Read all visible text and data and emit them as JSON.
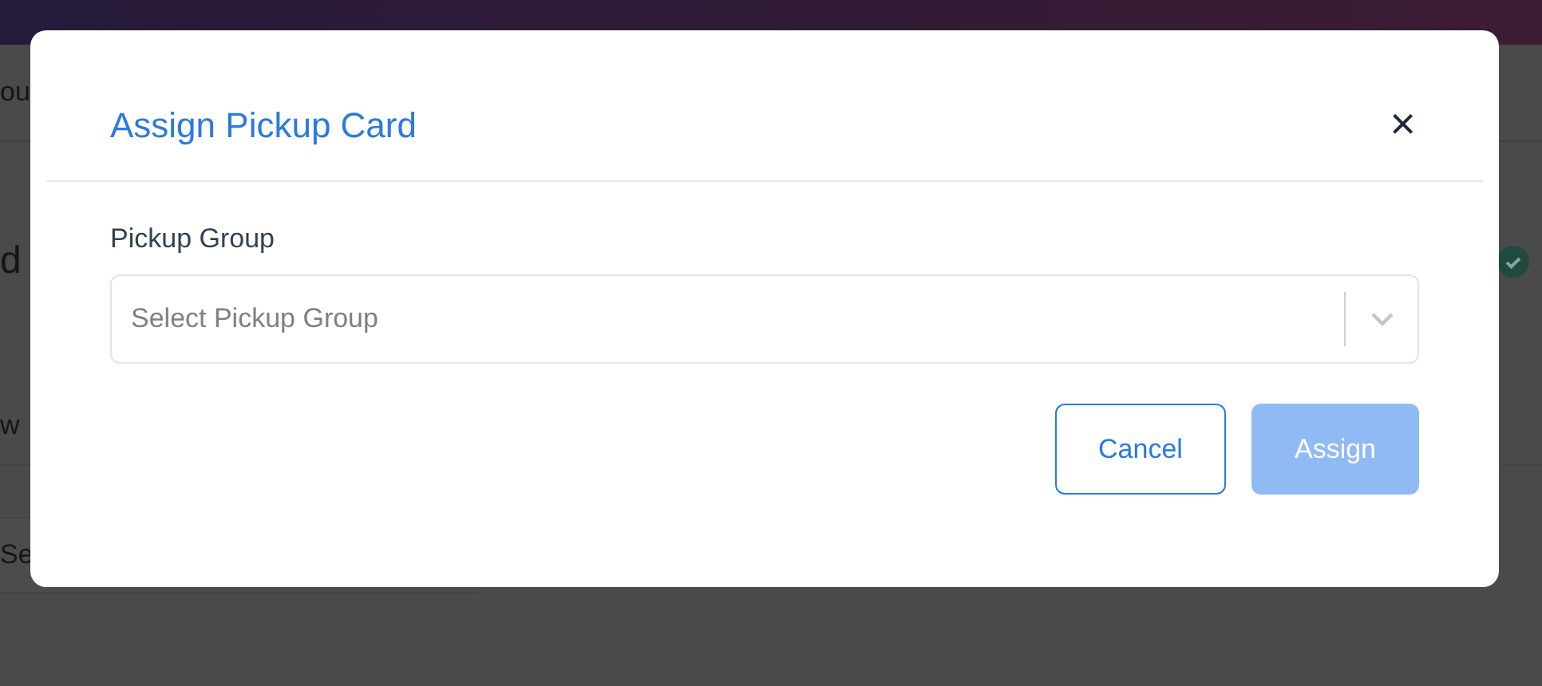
{
  "background": {
    "tab_text": "ou",
    "heading_text": "d",
    "section_text": "w",
    "search_placeholder": "Se",
    "status_done": true
  },
  "dialog": {
    "title": "Assign Pickup Card",
    "close": "×",
    "field": {
      "label": "Pickup Group",
      "placeholder": "Select Pickup Group"
    },
    "buttons": [
      {
        "label": "Cancel",
        "kind": "secondary",
        "disabled": false
      },
      {
        "label": "Assign",
        "kind": "primary",
        "disabled": true
      }
    ]
  }
}
